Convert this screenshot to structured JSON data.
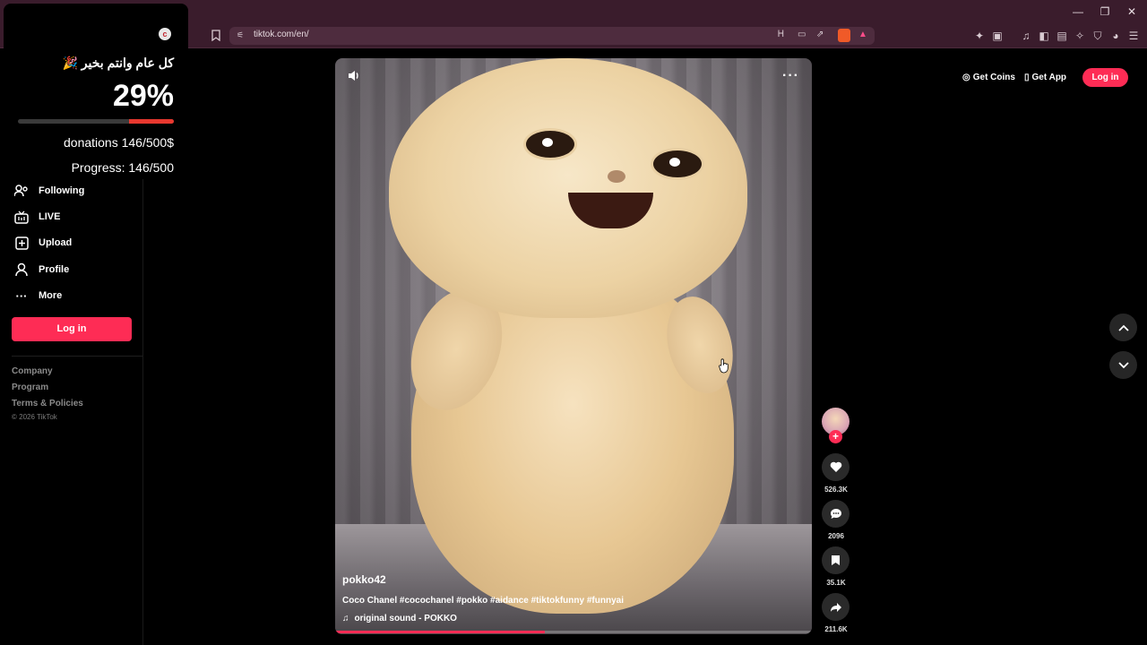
{
  "browser": {
    "url": "tiktok.com/en/",
    "window_controls": [
      "minimize-icon",
      "restore-icon",
      "close-icon"
    ]
  },
  "donation_widget": {
    "logo_letter": "c",
    "greeting": "كل عام وانتم بخير 🎉",
    "percent": "29%",
    "progress_fraction": 0.29,
    "amount_text": "donations 146/500$",
    "progress_text": "Progress: 146/500",
    "bar_color": "#e8382f"
  },
  "sidebar": {
    "items": [
      {
        "label": "Following",
        "icon": "following-icon"
      },
      {
        "label": "LIVE",
        "icon": "live-icon"
      },
      {
        "label": "Upload",
        "icon": "upload-icon"
      },
      {
        "label": "Profile",
        "icon": "profile-icon"
      },
      {
        "label": "More",
        "icon": "more-icon"
      }
    ],
    "login_label": "Log in",
    "footer_links": [
      "Company",
      "Program",
      "Terms & Policies"
    ],
    "copyright": "© 2026 TikTok"
  },
  "video": {
    "author": "pokko42",
    "description": "Coco Chanel #cocochanel #pokko #aidance #tiktokfunny #funnyai",
    "music": "original sound - POKKO",
    "progress_fraction": 0.44,
    "accent": "#fe2c55"
  },
  "actions": {
    "likes": "526.3K",
    "comments": "2096",
    "saves": "35.1K",
    "shares": "211.6K"
  },
  "top_actions": {
    "get_coins": "Get Coins",
    "get_app": "Get App",
    "login": "Log in"
  }
}
